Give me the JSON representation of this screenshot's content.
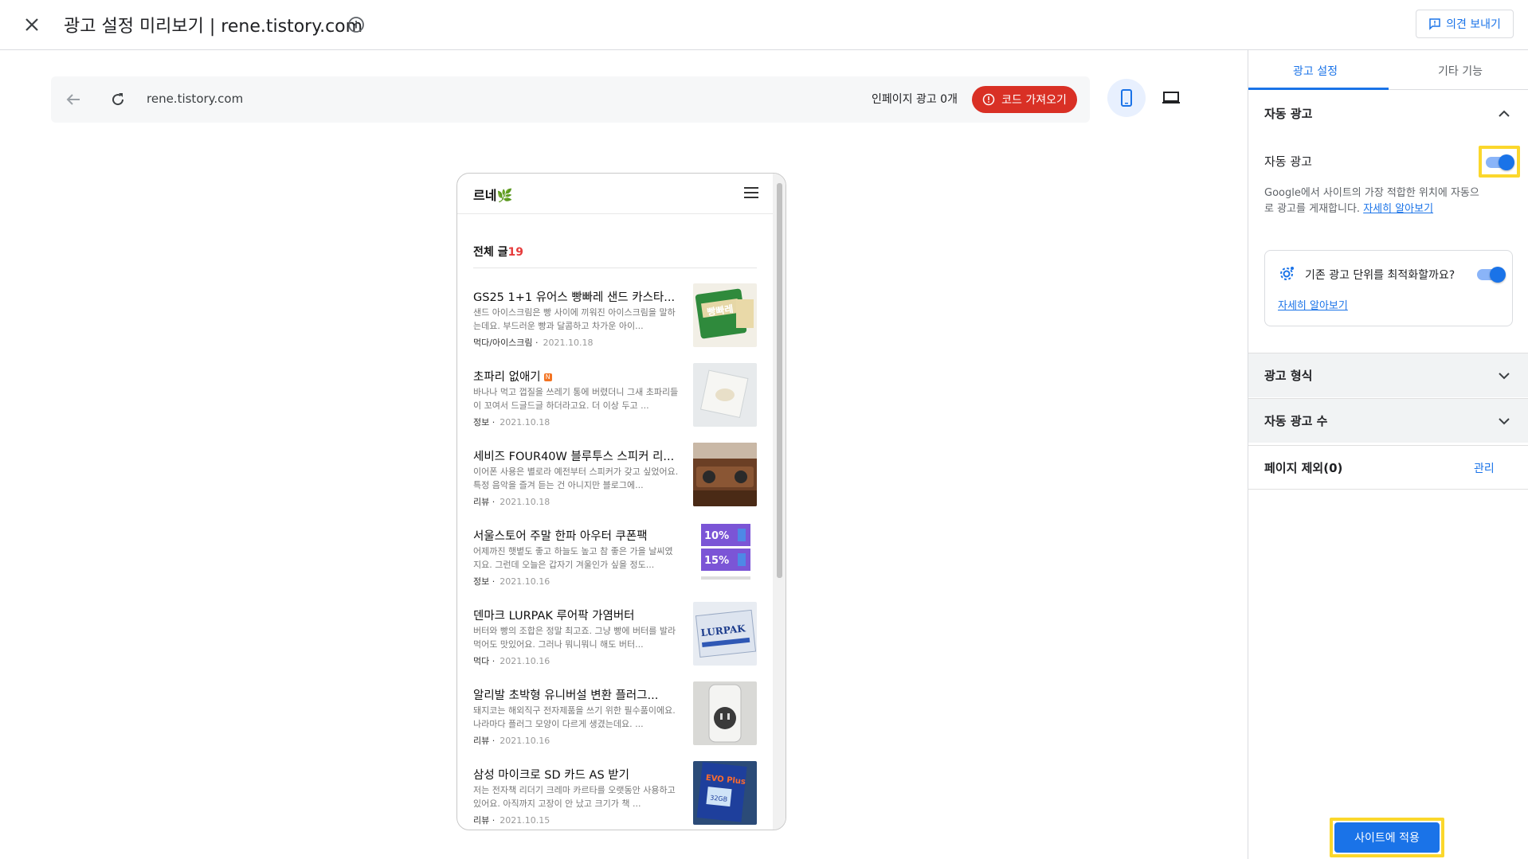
{
  "header": {
    "title": "광고 설정 미리보기 | rene.tistory.com",
    "feedback_label": "의견 보내기"
  },
  "preview_bar": {
    "url": "rene.tistory.com",
    "inpage_ads": "인페이지 광고 0개",
    "get_code_label": "코드 가져오기"
  },
  "blog": {
    "name": "르네🌿",
    "all_posts_label": "전체 글",
    "all_posts_count": "19",
    "posts": [
      {
        "title": "GS25 1+1 유어스 빵빠레 샌드 카스타...",
        "excerpt": "샌드 아이스크림은 빵 사이에 끼워진 아이스크림을 말하는데요. 부드러운 빵과 달콤하고 차가운 아이...",
        "category": "먹다/아이스크림",
        "date": "2021.10.18",
        "new": false
      },
      {
        "title": "초파리 없애기",
        "excerpt": "바나나 먹고 껍질을 쓰레기 통에 버렸더니 그새 초파리들이 꼬여서 드글드글 하더라고요. 더 이상 두고 ...",
        "category": "정보",
        "date": "2021.10.18",
        "new": true
      },
      {
        "title": "세비즈 FOUR40W 블루투스 스피커 리...",
        "excerpt": "이어폰 사용은 별로라 예전부터 스피커가 갖고 싶었어요. 특정 음악을 즐겨 듣는 건 아니지만 블로그에...",
        "category": "리뷰",
        "date": "2021.10.18",
        "new": false
      },
      {
        "title": "서울스토어 주말 한파 아우터 쿠폰팩",
        "excerpt": "어제까진 햇볕도 좋고 하늘도 높고 참 좋은 가을 날씨였지요. 그런데 오늘은 갑자기 겨울인가 싶을 정도...",
        "category": "정보",
        "date": "2021.10.16",
        "new": false
      },
      {
        "title": "덴마크 LURPAK 루어팍 가염버터",
        "excerpt": "버터와 빵의 조합은 정말 최고죠. 그냥 빵에 버터를 발라 먹어도 맛있어요. 그러나 뭐니뭐니 해도 버터...",
        "category": "먹다",
        "date": "2021.10.16",
        "new": false
      },
      {
        "title": "알리발 초박형 유니버설 변환 플러그...",
        "excerpt": "돼지코는 해외직구 전자제품을 쓰기 위한 필수품이에요. 나라마다 플러그 모양이 다르게 생겼는데요. ...",
        "category": "리뷰",
        "date": "2021.10.16",
        "new": false
      },
      {
        "title": "삼성 마이크로 SD 카드 AS 받기",
        "excerpt": "저는 전자책 리더기 크레마 카르타를 오랫동안 사용하고 있어요. 아직까지 고장이 안 났고 크기가 책 ...",
        "category": "리뷰",
        "date": "2021.10.15",
        "new": false
      }
    ],
    "thumb_labels": {
      "bbangbbare": "빵빠레",
      "coupon1": "10%",
      "coupon2": "15%",
      "lurpak": "LURPAK",
      "evo": "EVO Plus",
      "evo_size": "32GB"
    }
  },
  "panel": {
    "tabs": [
      "광고 설정",
      "기타 기능"
    ],
    "auto_ads_section": "자동 광고",
    "auto_ads_label": "자동 광고",
    "auto_ads_on": true,
    "auto_ads_desc": "Google에서 사이트의 가장 적합한 위치에 자동으로 광고를 게재합니다.",
    "learn_more": "자세히 알아보기",
    "optimize_question": "기존 광고 단위를 최적화할까요?",
    "optimize_on": true,
    "optimize_learn_more": "자세히 알아보기",
    "ad_formats": "광고 형식",
    "ad_load": "자동 광고 수",
    "page_exclusions": "페이지 제외(0)",
    "manage": "관리",
    "apply_label": "사이트에 적용"
  },
  "colors": {
    "accent": "#1a73e8",
    "danger": "#d93025",
    "highlight": "#fbd72c"
  }
}
